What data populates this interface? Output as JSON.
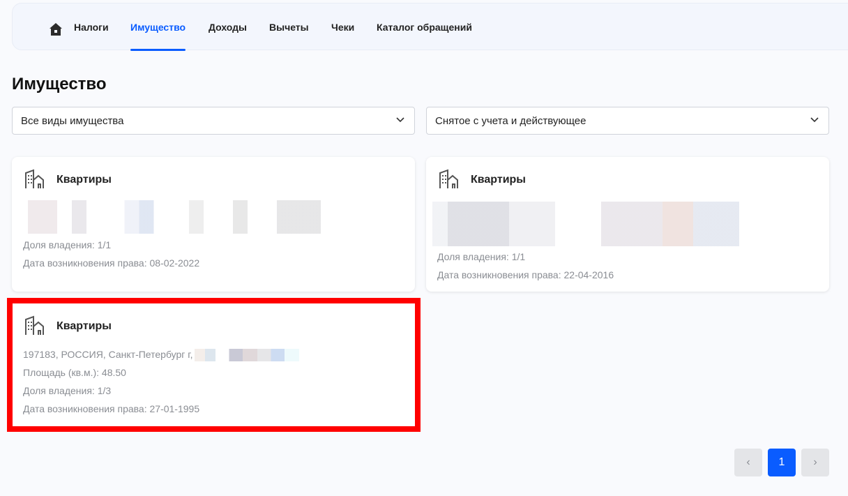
{
  "nav": {
    "tabs": [
      {
        "label": "Налоги"
      },
      {
        "label": "Имущество",
        "active": true
      },
      {
        "label": "Доходы"
      },
      {
        "label": "Вычеты"
      },
      {
        "label": "Чеки"
      },
      {
        "label": "Каталог обращений"
      }
    ]
  },
  "page_title": "Имущество",
  "filters": {
    "type": "Все виды имущества",
    "status": "Снятое с учета и действующее"
  },
  "cards": [
    {
      "title": "Квартиры",
      "share": "Доля владения: 1/1",
      "date": "Дата возникновения права: 08-02-2022"
    },
    {
      "title": "Квартиры",
      "share": "Доля владения: 1/1",
      "date": "Дата возникновения права: 22-04-2016"
    },
    {
      "title": "Квартиры",
      "address": "197183, РОССИЯ, Санкт-Петербург г,",
      "area": "Площадь (кв.м.): 48.50",
      "share": "Доля владения: 1/3",
      "date": "Дата возникновения права: 27-01-1995"
    }
  ],
  "pagination": {
    "prev": "‹",
    "current": "1",
    "next": "›"
  },
  "colors": {
    "accent": "#0a5cff",
    "highlight": "#ff0000"
  }
}
